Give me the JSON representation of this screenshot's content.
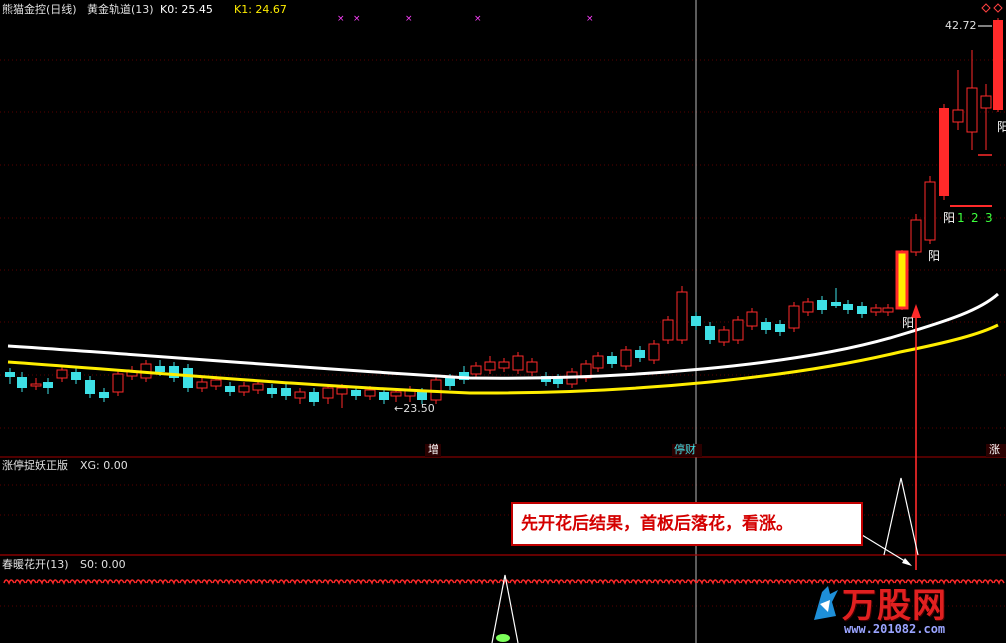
{
  "header": {
    "title": "熊猫金控(日线)",
    "indicator": "黄金轨道(13)",
    "k0_label": "K0: 25.45",
    "k1_label": "K1: 24.67"
  },
  "price_labels": {
    "high": "42.72",
    "low": "←23.50"
  },
  "markers": {
    "yang1": "阳",
    "yang2": "阳",
    "yang3": "阳",
    "yang4": "阳",
    "counts": [
      "1",
      "2",
      "3"
    ],
    "zeng": "增",
    "tingcai": "停财",
    "zhang": "涨"
  },
  "panel2": {
    "label": "涨停捉妖正版",
    "value": "XG: 0.00"
  },
  "panel3": {
    "label": "春暖花开(13)",
    "value": "S0: 0.00"
  },
  "callout": {
    "text": "先开花后结果，首板后落花，看涨。"
  },
  "watermark": {
    "brand": "万股网",
    "url": "www.201082.com"
  },
  "colors": {
    "up": "#ff2a2a",
    "down": "#3ee0e6",
    "ma_white": "#ffffff",
    "ma_yellow": "#ffee00",
    "separator": "#a00000",
    "signal": "#ffff00"
  }
}
